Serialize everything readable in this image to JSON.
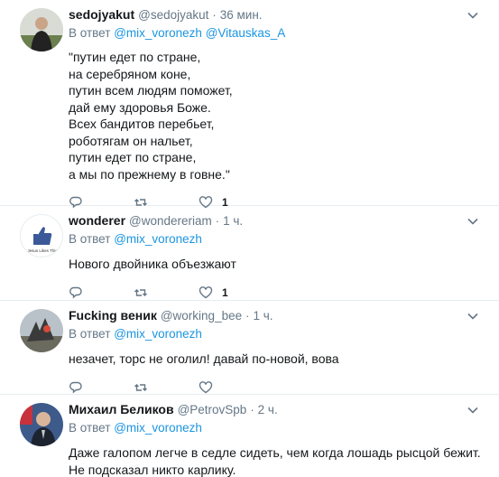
{
  "tweets": [
    {
      "name": "sedojyakut",
      "handle": "@sedojyakut",
      "dot": "·",
      "time": "36 мин.",
      "reply_prefix": "В ответ",
      "reply_to_1": "@mix_voronezh",
      "reply_to_2": "@Vitauskas_A",
      "text": "\"путин едет по стране,\nна серебряном коне,\nпутин всем людям поможет,\nдай ему здоровья Боже.\nВсех бандитов перебьет,\nроботягам он нальет,\nпутин едет по стране,\nа мы по прежнему в говне.\"",
      "likes": "1"
    },
    {
      "name": "wonderer",
      "handle": "@wondereriam",
      "dot": "·",
      "time": "1 ч.",
      "reply_prefix": "В ответ",
      "reply_to_1": "@mix_voronezh",
      "text": "Нового двойника объезжают",
      "likes": "1",
      "avatar_caption": "Jesus Likes This"
    },
    {
      "name": "Fucking веник",
      "handle": "@working_bee",
      "dot": "·",
      "time": "1 ч.",
      "text": "незачет, торс не оголил! давай по-новой, вова",
      "likes": "",
      "reply_prefix": "В ответ",
      "reply_to_1": "@mix_voronezh"
    },
    {
      "name": "Михаил Беликов",
      "handle": "@PetrovSpb",
      "dot": "·",
      "time": "2 ч.",
      "reply_prefix": "В ответ",
      "reply_to_1": "@mix_voronezh",
      "text": "Даже галопом легче в седле сидеть, чем когда лошадь рысцой бежит. Не подсказал никто карлику."
    }
  ],
  "icons": {
    "reply": "reply-icon",
    "retweet": "retweet-icon",
    "like": "heart-icon",
    "menu": "chevron-down-icon"
  },
  "colors": {
    "link": "#1b95e0",
    "muted": "#657786",
    "divider": "#e6ecf0"
  }
}
